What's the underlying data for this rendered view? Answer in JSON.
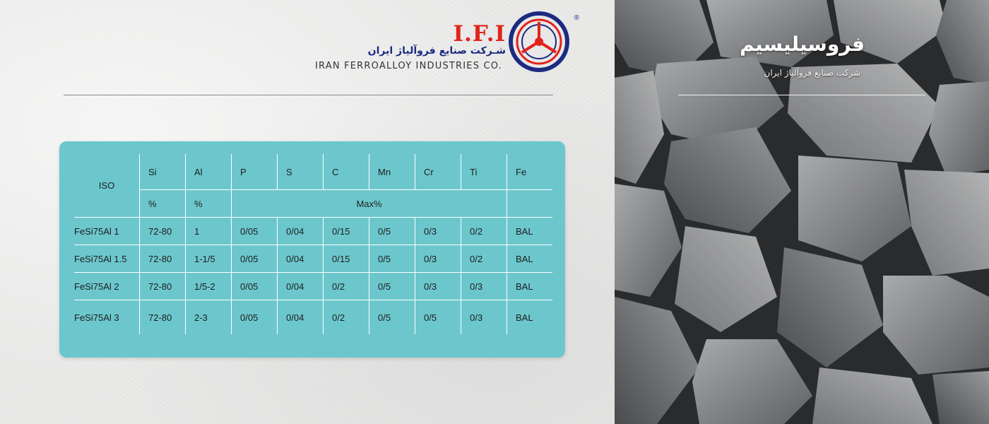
{
  "logo": {
    "mark": "I.F.I",
    "name_fa": "شـرکت صنایع فروآلیاژ ایران",
    "name_en": "IRAN FERROALLOY INDUSTRIES CO.",
    "registered": "®",
    "colors": {
      "red": "#e2231a",
      "blue": "#1c2b80"
    }
  },
  "hero": {
    "title": "فروسیلیسیم",
    "subtitle": "شرکت صنایع فروآلیاژ ایران"
  },
  "table": {
    "iso_label": "ISO",
    "columns": [
      "Si",
      "Al",
      "P",
      "S",
      "C",
      "Mn",
      "Cr",
      "Ti",
      "Fe"
    ],
    "units": {
      "si": "%",
      "al": "%",
      "others": "Max%"
    },
    "rows": [
      {
        "iso": "FeSi75Al 1",
        "cells": [
          "72-80",
          "1",
          "0/05",
          "0/04",
          "0/15",
          "0/5",
          "0/3",
          "0/2",
          "BAL"
        ]
      },
      {
        "iso": "FeSi75Al 1.5",
        "cells": [
          "72-80",
          "1-1/5",
          "0/05",
          "0/04",
          "0/15",
          "0/5",
          "0/3",
          "0/2",
          "BAL"
        ]
      },
      {
        "iso": "FeSi75Al 2",
        "cells": [
          "72-80",
          "1/5-2",
          "0/05",
          "0/04",
          "0/2",
          "0/5",
          "0/3",
          "0/3",
          "BAL"
        ]
      },
      {
        "iso": "FeSi75Al 3",
        "cells": [
          "72-80",
          "2-3",
          "0/05",
          "0/04",
          "0/2",
          "0/5",
          "0/5",
          "0/3",
          "BAL"
        ]
      }
    ],
    "card_color": "#6cc7cc"
  }
}
